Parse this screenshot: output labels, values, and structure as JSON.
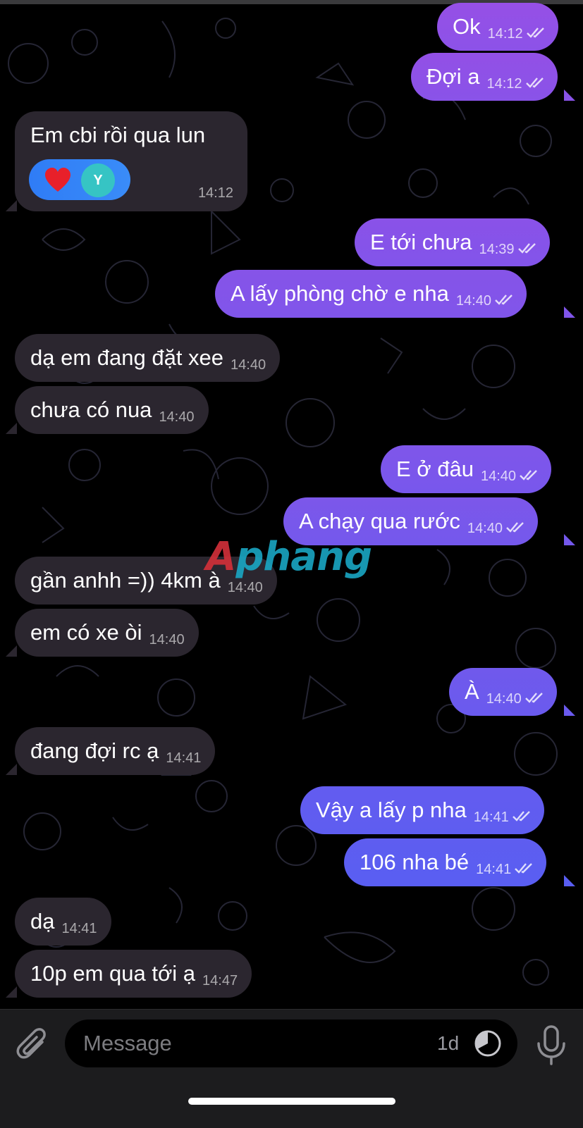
{
  "colors": {
    "incoming_bubble": "#2b262f",
    "outgoing_gradient_top": "#8f4fe6",
    "outgoing_gradient_bottom": "#5b5ff2",
    "reaction_bg": "#2f7cf6",
    "background": "#000000"
  },
  "messages": [
    {
      "dir": "out",
      "text": "Ok",
      "time": "14:12"
    },
    {
      "dir": "out",
      "text": "Đợi a",
      "time": "14:12"
    },
    {
      "dir": "in",
      "text": "Em cbi rồi qua lun",
      "time": "14:12",
      "reaction": {
        "emoji": "heart",
        "avatar_initial": "Y"
      }
    },
    {
      "dir": "out",
      "text": "E tới chưa",
      "time": "14:39"
    },
    {
      "dir": "out",
      "text": "A lấy phòng chờ e nha",
      "time": "14:40"
    },
    {
      "dir": "in",
      "text": "dạ em đang đặt xee",
      "time": "14:40"
    },
    {
      "dir": "in",
      "text": "chưa có nua",
      "time": "14:40"
    },
    {
      "dir": "out",
      "text": "E ở đâu",
      "time": "14:40"
    },
    {
      "dir": "out",
      "text": "A chạy qua rước",
      "time": "14:40"
    },
    {
      "dir": "in",
      "text": "gần anhh =)) 4km à",
      "time": "14:40"
    },
    {
      "dir": "in",
      "text": "em có xe òi",
      "time": "14:40"
    },
    {
      "dir": "out",
      "text": "À",
      "time": "14:40"
    },
    {
      "dir": "in",
      "text": "đang đợi rc ạ",
      "time": "14:41"
    },
    {
      "dir": "out",
      "text": "Vậy a lấy p nha",
      "time": "14:41"
    },
    {
      "dir": "out",
      "text": "106 nha bé",
      "time": "14:41"
    },
    {
      "dir": "in",
      "text": "dạ",
      "time": "14:41"
    },
    {
      "dir": "in",
      "text": "10p em qua tới ạ",
      "time": "14:47"
    }
  ],
  "watermark": {
    "first": "A",
    "rest": "phang"
  },
  "composer": {
    "placeholder": "Message",
    "timer_label": "1d",
    "attach_icon": "paperclip-icon",
    "timer_icon": "timer-icon",
    "mic_icon": "microphone-icon"
  }
}
